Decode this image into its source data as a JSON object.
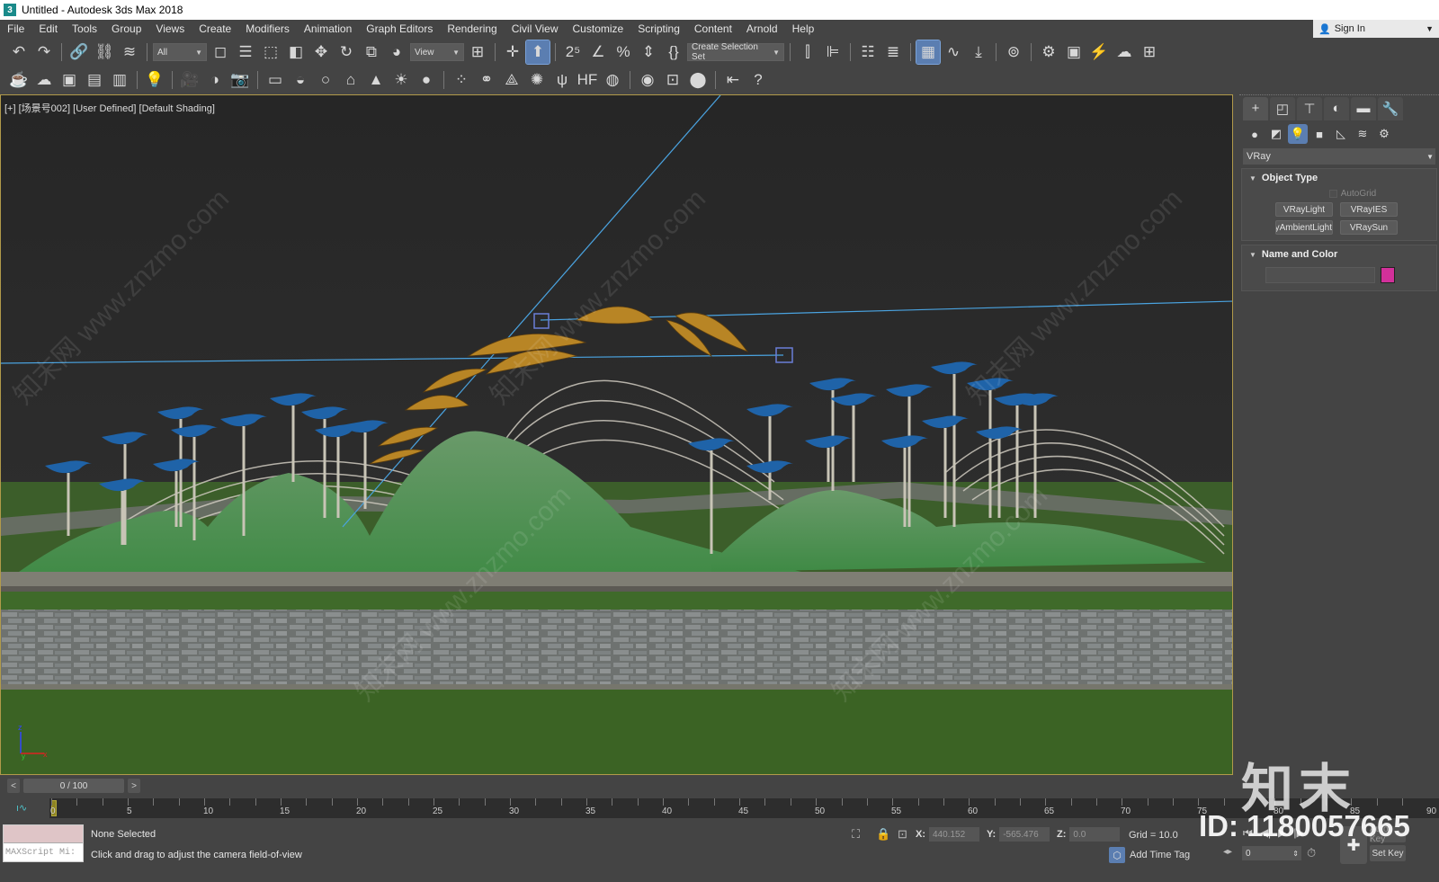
{
  "window": {
    "title": "Untitled - Autodesk 3ds Max 2018",
    "app_icon_glyph": "3"
  },
  "menu": [
    {
      "label": "File"
    },
    {
      "label": "Edit"
    },
    {
      "label": "Tools"
    },
    {
      "label": "Group"
    },
    {
      "label": "Views"
    },
    {
      "label": "Create"
    },
    {
      "label": "Modifiers"
    },
    {
      "label": "Animation"
    },
    {
      "label": "Graph Editors"
    },
    {
      "label": "Rendering"
    },
    {
      "label": "Civil View"
    },
    {
      "label": "Customize"
    },
    {
      "label": "Scripting"
    },
    {
      "label": "Content"
    },
    {
      "label": "Arnold"
    },
    {
      "label": "Help"
    }
  ],
  "signin": {
    "label": "Sign In"
  },
  "toolbar": {
    "selection_filter": "All",
    "reference_coord": "View",
    "named_selection": "Create Selection Set",
    "icons_row1": [
      {
        "name": "undo-icon",
        "glyph": "↶"
      },
      {
        "name": "redo-icon",
        "glyph": "↷"
      },
      {
        "name": "link-icon",
        "glyph": "🔗"
      },
      {
        "name": "unlink-icon",
        "glyph": "⛓"
      },
      {
        "name": "bind-spacewarp-icon",
        "glyph": "≋"
      }
    ],
    "icons_row1b": [
      {
        "name": "select-object-icon",
        "glyph": "◻"
      },
      {
        "name": "select-by-name-icon",
        "glyph": "☰"
      },
      {
        "name": "rect-selection-icon",
        "glyph": "⬚"
      },
      {
        "name": "window-crossing-icon",
        "glyph": "◧"
      },
      {
        "name": "move-icon",
        "glyph": "✥"
      },
      {
        "name": "rotate-icon",
        "glyph": "↻"
      },
      {
        "name": "scale-icon",
        "glyph": "⧉"
      },
      {
        "name": "placement-icon",
        "glyph": "◕"
      }
    ],
    "icons_row1c": [
      {
        "name": "pivot-icon",
        "glyph": "⊞"
      },
      {
        "name": "select-manipulate-icon",
        "glyph": "✛"
      },
      {
        "name": "keyboard-shortcut-icon",
        "glyph": "⬆"
      }
    ],
    "icons_row1d": [
      {
        "name": "snaps-toggle-icon",
        "glyph": "2⁵"
      },
      {
        "name": "angle-snap-icon",
        "glyph": "∠"
      },
      {
        "name": "percent-snap-icon",
        "glyph": "%"
      },
      {
        "name": "spinner-snap-icon",
        "glyph": "⇕"
      },
      {
        "name": "edit-named-selections-icon",
        "glyph": "{}"
      }
    ],
    "icons_row1e": [
      {
        "name": "mirror-icon",
        "glyph": "⫿"
      },
      {
        "name": "align-icon",
        "glyph": "⊫"
      },
      {
        "name": "scene-explorer-icon",
        "glyph": "☷"
      },
      {
        "name": "layer-explorer-icon",
        "glyph": "≣"
      },
      {
        "name": "toggle-ribbon-icon",
        "glyph": "▦"
      },
      {
        "name": "curve-editor-icon",
        "glyph": "∿"
      },
      {
        "name": "dope-sheet-icon",
        "glyph": "⤓"
      },
      {
        "name": "material-editor-icon",
        "glyph": "⊚"
      },
      {
        "name": "render-setup-icon",
        "glyph": "⚙"
      },
      {
        "name": "rendered-frame-window-icon",
        "glyph": "▣"
      },
      {
        "name": "render-production-icon",
        "glyph": "⚡"
      },
      {
        "name": "render-cloud-icon",
        "glyph": "☁"
      },
      {
        "name": "viewport-layout-icon",
        "glyph": "⊞"
      }
    ],
    "icons_row2": [
      {
        "name": "teapot-icon",
        "glyph": "☕"
      },
      {
        "name": "cloud-icon",
        "glyph": "☁"
      },
      {
        "name": "frame-buffer-icon",
        "glyph": "▣"
      },
      {
        "name": "log-window-icon",
        "glyph": "▤"
      },
      {
        "name": "vray-settings-icon",
        "glyph": "▥"
      },
      {
        "name": "light-lister-icon",
        "glyph": "💡"
      },
      {
        "name": "camera-icon",
        "glyph": "🎥"
      },
      {
        "name": "physical-camera-icon",
        "glyph": "◑"
      },
      {
        "name": "dome-camera-icon",
        "glyph": "📷"
      },
      {
        "name": "vray-light-plane-icon",
        "glyph": "▭"
      },
      {
        "name": "vray-light-dome-icon",
        "glyph": "◒"
      },
      {
        "name": "vray-light-sphere-icon",
        "glyph": "○"
      },
      {
        "name": "vray-light-mesh-icon",
        "glyph": "⌂"
      },
      {
        "name": "vray-ies-icon",
        "glyph": "▲"
      },
      {
        "name": "vray-sun-icon",
        "glyph": "☀"
      },
      {
        "name": "vray-ambient-icon",
        "glyph": "●"
      },
      {
        "name": "vray-proxy-icon",
        "glyph": "⁘"
      },
      {
        "name": "vray-instancer-icon",
        "glyph": "⚭"
      },
      {
        "name": "vray-plane-icon",
        "glyph": "⟁"
      },
      {
        "name": "vray-clipper-icon",
        "glyph": "✺"
      },
      {
        "name": "vray-fur-icon",
        "glyph": "ψ"
      },
      {
        "name": "vray-hair-icon",
        "glyph": "HF"
      },
      {
        "name": "vray-ornatrix-icon",
        "glyph": "◍"
      },
      {
        "name": "vray-material-ball-icon",
        "glyph": "◉"
      },
      {
        "name": "vray-mtl-convert-icon",
        "glyph": "⊡"
      },
      {
        "name": "vray-vfb-icon",
        "glyph": "⬤"
      },
      {
        "name": "vray-export-icon",
        "glyph": "⇤"
      },
      {
        "name": "vray-help-icon",
        "glyph": "?"
      }
    ]
  },
  "viewport": {
    "label_parts": [
      "[+]",
      "[场景号002]",
      "[User Defined]",
      "[Default Shading]"
    ],
    "axis": {
      "z": "z",
      "x": "x",
      "y": "y"
    }
  },
  "command_panel": {
    "tabs": [
      {
        "name": "create-tab",
        "glyph": "+"
      },
      {
        "name": "modify-tab",
        "glyph": "◰"
      },
      {
        "name": "hierarchy-tab",
        "glyph": "⊤"
      },
      {
        "name": "motion-tab",
        "glyph": "◐"
      },
      {
        "name": "display-tab",
        "glyph": "▬"
      },
      {
        "name": "utilities-tab",
        "glyph": "🔧"
      }
    ],
    "categories": [
      {
        "name": "geometry-category-icon",
        "glyph": "●"
      },
      {
        "name": "shapes-category-icon",
        "glyph": "◩"
      },
      {
        "name": "lights-category-icon",
        "glyph": "💡"
      },
      {
        "name": "cameras-category-icon",
        "glyph": "■"
      },
      {
        "name": "helpers-category-icon",
        "glyph": "◺"
      },
      {
        "name": "spacewarps-category-icon",
        "glyph": "≋"
      },
      {
        "name": "systems-category-icon",
        "glyph": "⚙"
      }
    ],
    "renderer_dropdown": "VRay",
    "object_type": {
      "title": "Object Type",
      "autogrid": "AutoGrid",
      "buttons": [
        "VRayLight",
        "VRayIES",
        "VRayAmbientLight",
        "VRaySun"
      ]
    },
    "name_and_color": {
      "title": "Name and Color",
      "name_value": "",
      "color": "#d2309a"
    }
  },
  "timeline": {
    "slider_text": "0 / 100",
    "prev": "<",
    "next": ">",
    "current_frame": 0,
    "ticks": [
      0,
      5,
      10,
      15,
      20,
      25,
      30,
      35,
      40,
      45,
      50,
      55,
      60,
      65,
      70,
      75,
      80,
      85,
      90
    ]
  },
  "status": {
    "maxscript_placeholder": "MAXScript Mi:",
    "selection": "None Selected",
    "prompt": "Click and drag to adjust the camera field-of-view",
    "x_label": "X:",
    "x": "440.152",
    "y_label": "Y:",
    "y": "-565.476",
    "z_label": "Z:",
    "z": "0.0",
    "grid": "Grid = 10.0",
    "add_time_tag": "Add Time Tag",
    "frame_field": "0",
    "auto_key": "Auto Key",
    "set_key": "Set Key"
  },
  "watermark": {
    "brand": "知末",
    "id": "ID: 1180057665",
    "diag": "知末网 www.znzmo.com"
  }
}
